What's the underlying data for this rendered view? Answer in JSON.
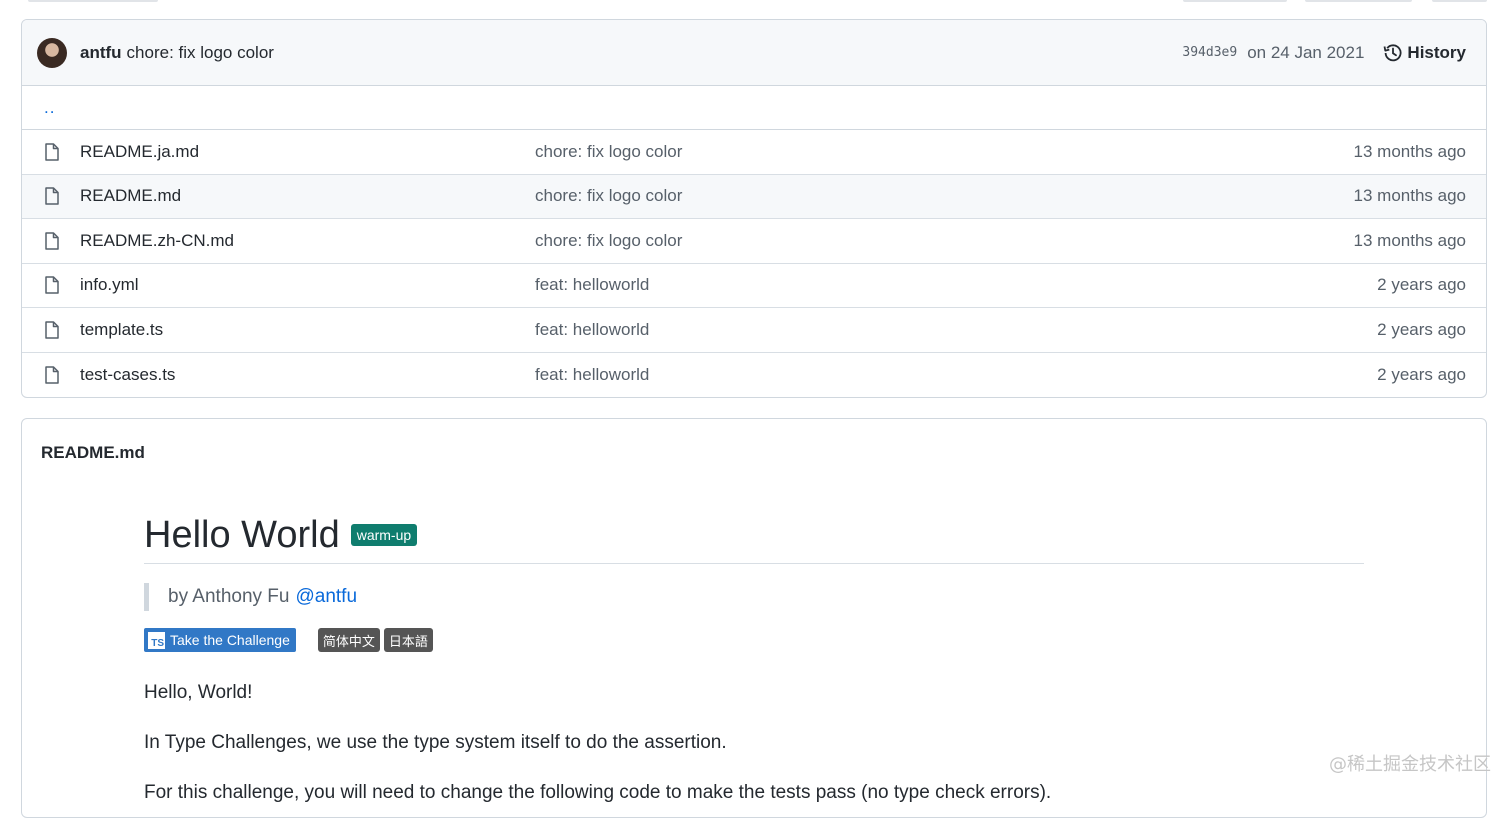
{
  "commit": {
    "author": "antfu",
    "message": "chore: fix logo color",
    "sha": "394d3e9",
    "date": "on 24 Jan 2021",
    "history_label": "History"
  },
  "up_dir": "..",
  "files": [
    {
      "name": "README.ja.md",
      "message": "chore: fix logo color",
      "age": "13 months ago"
    },
    {
      "name": "README.md",
      "message": "chore: fix logo color",
      "age": "13 months ago"
    },
    {
      "name": "README.zh-CN.md",
      "message": "chore: fix logo color",
      "age": "13 months ago"
    },
    {
      "name": "info.yml",
      "message": "feat: helloworld",
      "age": "2 years ago"
    },
    {
      "name": "template.ts",
      "message": "feat: helloworld",
      "age": "2 years ago"
    },
    {
      "name": "test-cases.ts",
      "message": "feat: helloworld",
      "age": "2 years ago"
    }
  ],
  "readme": {
    "file_title": "README.md",
    "heading": "Hello World",
    "tag": "warm-up",
    "byline_prefix": "by Anthony Fu",
    "byline_handle": "@antfu",
    "badge_ts_icon": "TS",
    "badge_challenge": "Take the Challenge",
    "badge_zh": "简体中文",
    "badge_ja": "日本語",
    "paragraphs": [
      "Hello, World!",
      "In Type Challenges, we use the type system itself to do the assertion.",
      "For this challenge, you will need to change the following code to make the tests pass (no type check errors)."
    ]
  },
  "watermark": "@稀土掘金技术社区",
  "icons": {
    "file": "file-icon",
    "history": "history-clock-icon"
  }
}
